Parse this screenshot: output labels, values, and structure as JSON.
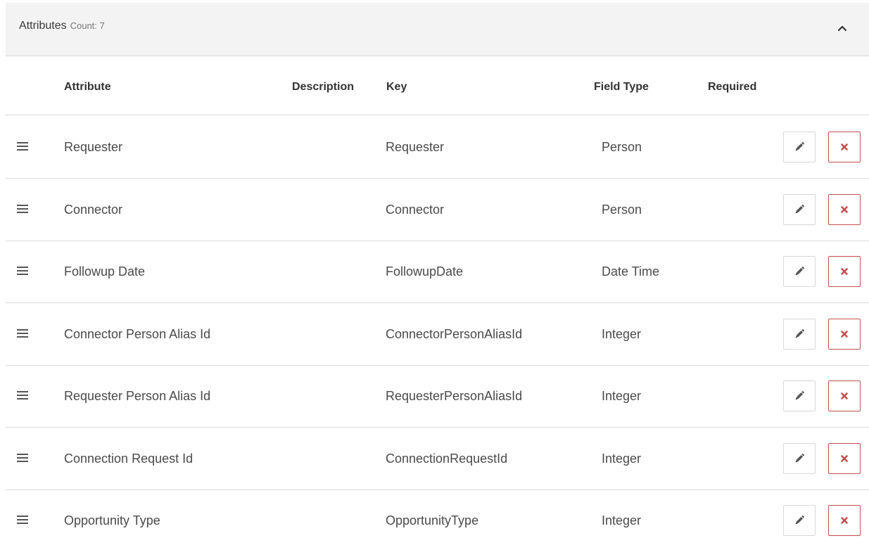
{
  "panel": {
    "title": "Attributes",
    "count_label": "Count: 7",
    "collapse_icon": "chevron-up-icon"
  },
  "table": {
    "headers": {
      "attribute": "Attribute",
      "description": "Description",
      "key": "Key",
      "field_type": "Field Type",
      "required": "Required"
    },
    "rows": [
      {
        "attribute": "Requester",
        "description": "",
        "key": "Requester",
        "field_type": "Person",
        "required": ""
      },
      {
        "attribute": "Connector",
        "description": "",
        "key": "Connector",
        "field_type": "Person",
        "required": ""
      },
      {
        "attribute": "Followup Date",
        "description": "",
        "key": "FollowupDate",
        "field_type": "Date Time",
        "required": ""
      },
      {
        "attribute": "Connector Person Alias Id",
        "description": "",
        "key": "ConnectorPersonAliasId",
        "field_type": "Integer",
        "required": ""
      },
      {
        "attribute": "Requester Person Alias Id",
        "description": "",
        "key": "RequesterPersonAliasId",
        "field_type": "Integer",
        "required": ""
      },
      {
        "attribute": "Connection Request Id",
        "description": "",
        "key": "ConnectionRequestId",
        "field_type": "Integer",
        "required": ""
      },
      {
        "attribute": "Opportunity Type",
        "description": "",
        "key": "OpportunityType",
        "field_type": "Integer",
        "required": ""
      }
    ]
  },
  "icons": {
    "drag": "drag-handle-icon",
    "edit": "pencil-icon",
    "delete": "close-icon"
  },
  "colors": {
    "header_bg": "#f3f3f3",
    "delete_red": "#c0504d",
    "text": "#4a4a4a"
  }
}
